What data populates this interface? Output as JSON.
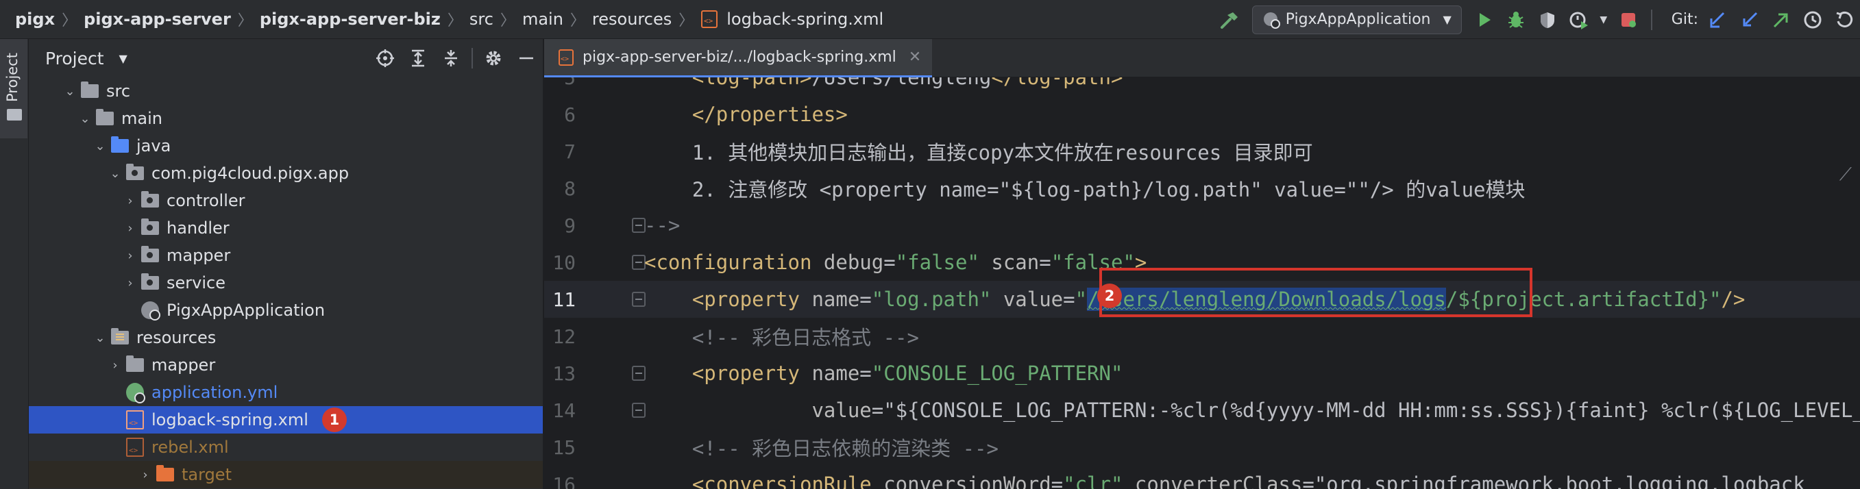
{
  "breadcrumb": {
    "items": [
      "pigx",
      "pigx-app-server",
      "pigx-app-server-biz",
      "src",
      "main",
      "resources",
      "logback-spring.xml"
    ]
  },
  "toolbar": {
    "run_config": "PigxAppApplication",
    "git_label": "Git:",
    "icons": [
      "hammer-icon",
      "run-icon",
      "debug-icon",
      "coverage-icon",
      "profile-icon",
      "stop-icon",
      "git-update-icon",
      "git-commit-icon",
      "git-push-icon",
      "history-icon",
      "rollback-icon"
    ]
  },
  "stripe": {
    "project_tab": "Project"
  },
  "project_panel": {
    "title": "Project",
    "tree": [
      {
        "label": "src",
        "depth": 0,
        "arrow": "v",
        "icon": "folder"
      },
      {
        "label": "main",
        "depth": 1,
        "arrow": "v",
        "icon": "folder"
      },
      {
        "label": "java",
        "depth": 2,
        "arrow": "v",
        "icon": "folder-blue"
      },
      {
        "label": "com.pig4cloud.pigx.app",
        "depth": 3,
        "arrow": "v",
        "icon": "package"
      },
      {
        "label": "controller",
        "depth": 4,
        "arrow": ">",
        "icon": "package"
      },
      {
        "label": "handler",
        "depth": 4,
        "arrow": ">",
        "icon": "package"
      },
      {
        "label": "mapper",
        "depth": 4,
        "arrow": ">",
        "icon": "package"
      },
      {
        "label": "service",
        "depth": 4,
        "arrow": ">",
        "icon": "package"
      },
      {
        "label": "PigxAppApplication",
        "depth": 4,
        "arrow": "",
        "icon": "spring-app"
      },
      {
        "label": "resources",
        "depth": 2,
        "arrow": "v",
        "icon": "resources"
      },
      {
        "label": "mapper",
        "depth": 3,
        "arrow": ">",
        "icon": "folder"
      },
      {
        "label": "application.yml",
        "depth": 3,
        "arrow": "",
        "icon": "yml"
      },
      {
        "label": "logback-spring.xml",
        "depth": 3,
        "arrow": "",
        "icon": "xml",
        "selected": true,
        "badge": "1"
      },
      {
        "label": "rebel.xml",
        "depth": 3,
        "arrow": "",
        "icon": "xml"
      },
      {
        "label": "target",
        "depth": 0,
        "arrow": ">",
        "icon": "folder-orange"
      }
    ]
  },
  "editor": {
    "tab_label": "pigx-app-server-biz/.../logback-spring.xml",
    "badge": "2",
    "lines": [
      {
        "n": "5",
        "text": "    <log-path>/Users/lengleng</log-path>"
      },
      {
        "n": "6",
        "text": "    </properties>"
      },
      {
        "n": "7",
        "text": "    1. 其他模块加日志输出，直接copy本文件放在resources 目录即可"
      },
      {
        "n": "8",
        "text": "    2. 注意修改 <property name=\"${log-path}/log.path\" value=\"\"/> 的value模块"
      },
      {
        "n": "9",
        "text": "-->"
      },
      {
        "n": "10",
        "text": "<configuration debug=\"false\" scan=\"false\">"
      },
      {
        "n": "11",
        "text": "    <property name=\"log.path\" value=\"/Users/lengleng/Downloads/logs/${project.artifactId}\"/>",
        "highlight": "/Users/lengleng/Downloads/logs"
      },
      {
        "n": "12",
        "text": "    <!-- 彩色日志格式 -->"
      },
      {
        "n": "13",
        "text": "    <property name=\"CONSOLE_LOG_PATTERN\""
      },
      {
        "n": "14",
        "text": "              value=\"${CONSOLE_LOG_PATTERN:-%clr(%d{yyyy-MM-dd HH:mm:ss.SSS}){faint} %clr(${LOG_LEVEL_PATTERN"
      },
      {
        "n": "15",
        "text": "    <!-- 彩色日志依赖的渲染类 -->"
      },
      {
        "n": "16",
        "text": "    <conversionRule conversionWord=\"clr\" converterClass=\"org.springframework.boot.logging.logback"
      }
    ]
  },
  "colors": {
    "selection": "#2e55c4",
    "badge": "#d33a2c",
    "tag": "#d5b778",
    "string": "#6aab73",
    "comment": "#7a7e85"
  }
}
